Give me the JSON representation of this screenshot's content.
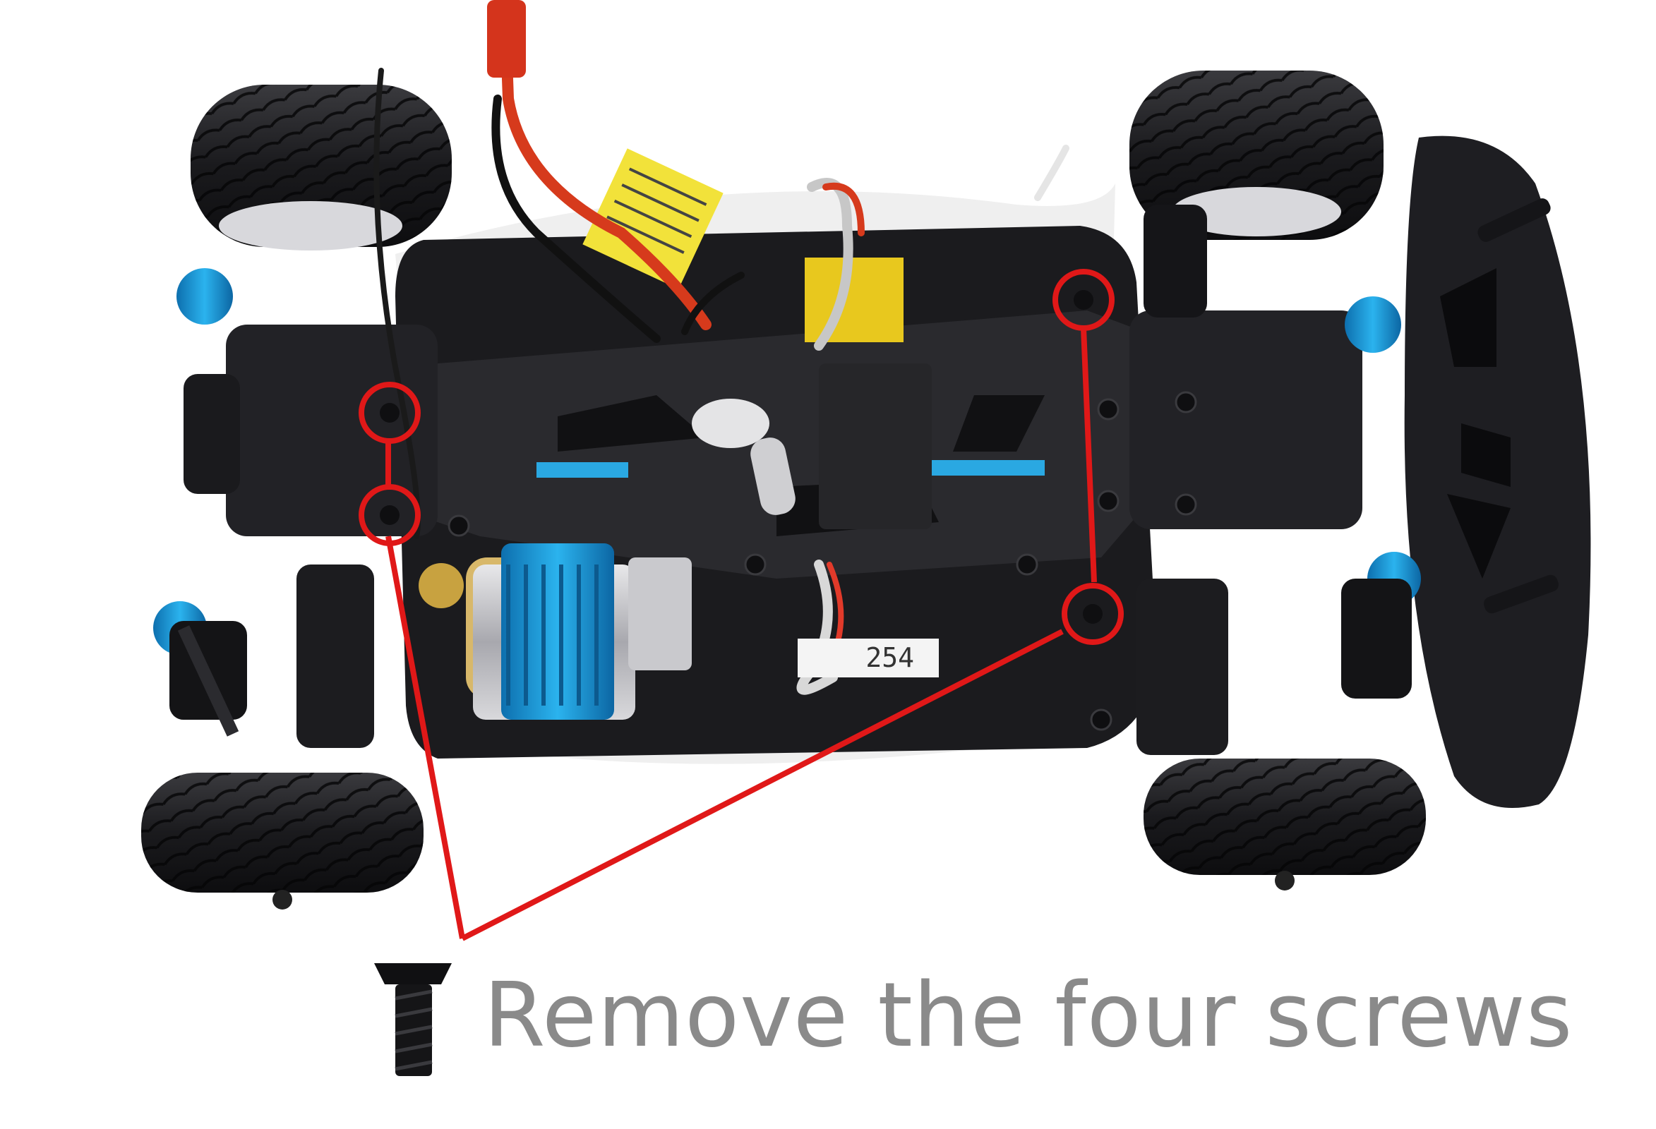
{
  "instruction": {
    "text": "Remove the four screws",
    "icon": "flat-head-screw-icon"
  },
  "label_plate": {
    "text": "254"
  },
  "colors": {
    "highlight": "#e01818",
    "caption": "#8a8a8a",
    "chassis": "#1b1b1e",
    "accent_blue": "#1aa0d8",
    "warning_yellow": "#f2e23a"
  },
  "callouts": {
    "count": 4,
    "items": [
      {
        "name": "screw-front-left-top"
      },
      {
        "name": "screw-front-left-bottom"
      },
      {
        "name": "screw-rear-right-top"
      },
      {
        "name": "screw-rear-right-bottom"
      }
    ]
  }
}
